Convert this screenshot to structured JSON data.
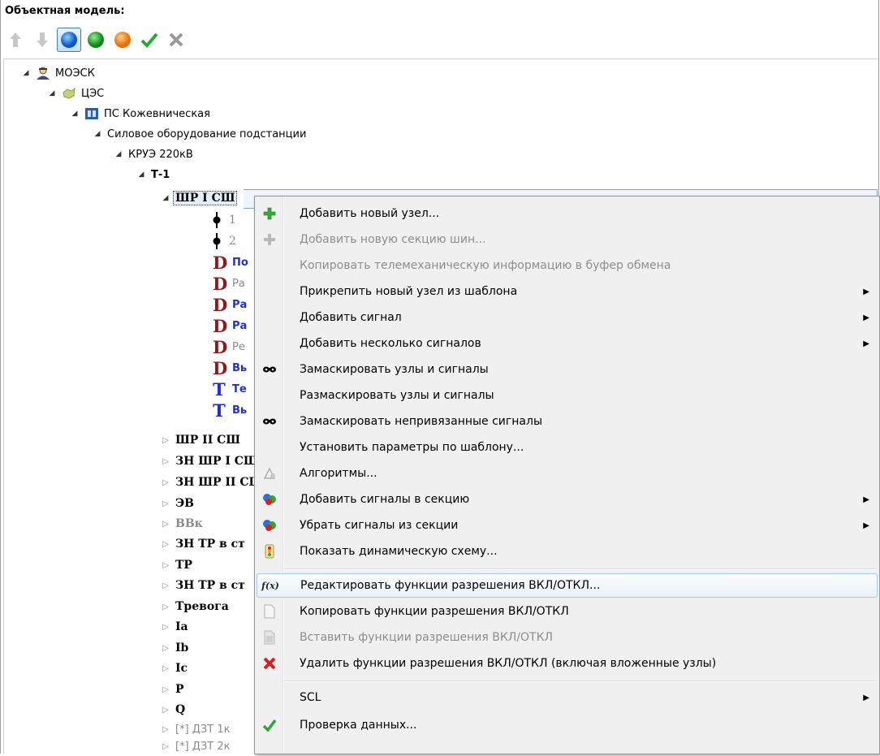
{
  "panel": {
    "title": "Объектная модель:"
  },
  "tree": {
    "root": "МОЭСК",
    "ces": "ЦЭС",
    "ps": "ПС Кожевническая",
    "equip": "Силовое оборудование подстанции",
    "kruz": "КРУЭ 220кВ",
    "t1": "Т-1",
    "shr1": "ШР I СШ",
    "n1": "1",
    "n2": "2",
    "d1": "По",
    "d2": "Ра",
    "d3": "Ра",
    "d4": "Ра",
    "d5": "Ре",
    "d6": "Вь",
    "t_a": "Те",
    "t_b": "Вь",
    "collapsed": [
      "ШР II СШ",
      "ЗН ШР I СШ",
      "ЗН ШР II СШ",
      "ЭВ",
      "ВВк",
      "ЗН ТР в ст",
      "ТР",
      "ЗН ТР в ст",
      "Тревога",
      "Ia",
      "Ib",
      "Ic",
      "P",
      "Q",
      "[*] ДЗТ 1к",
      "[*] ДЗТ 2к"
    ]
  },
  "menu": {
    "add_node": "Добавить новый узел...",
    "add_section": "Добавить новую секцию шин...",
    "copy_tm": "Копировать телемеханическую информацию в буфер обмена",
    "attach_template": "Прикрепить новый узел из шаблона",
    "add_signal": "Добавить сигнал",
    "add_signals": "Добавить несколько сигналов",
    "mask": "Замаскировать узлы и сигналы",
    "unmask": "Размаскировать узлы и сигналы",
    "mask_unbound": "Замаскировать непривязанные сигналы",
    "set_params": "Установить параметры по шаблону...",
    "algorithms": "Алгоритмы...",
    "add_to_section": "Добавить сигналы в секцию",
    "remove_from_section": "Убрать сигналы из секции",
    "show_scheme": "Показать динамическую схему...",
    "edit_func": "Редактировать функции разрешения ВКЛ/ОТКЛ...",
    "copy_func": "Копировать функции разрешения ВКЛ/ОТКЛ",
    "paste_func": "Вставить функции разрешения ВКЛ/ОТКЛ",
    "delete_func": "Удалить функции разрешения ВКЛ/ОТКЛ (включая вложенные узлы)",
    "scl": "SCL",
    "check": "Проверка данных...",
    "fx_icon_text": "f(x)"
  },
  "colors": {
    "accent": "#3c7fb1",
    "node_blue": "#1f2fd6",
    "d_red": "#8b1a1a",
    "delete_red": "#d42020"
  }
}
